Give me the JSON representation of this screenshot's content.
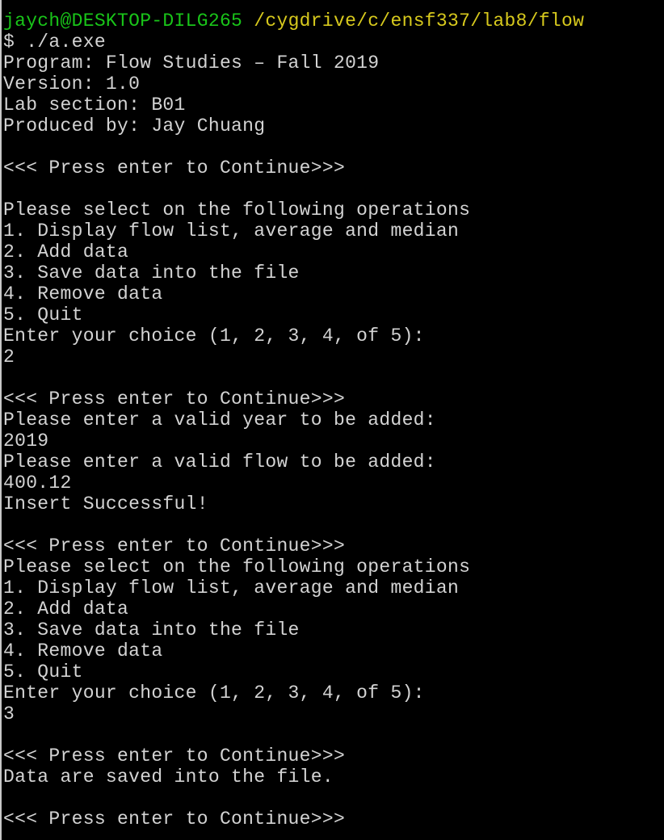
{
  "colors": {
    "background": "#000000",
    "text": "#d3d3d3",
    "prompt_user": "#19c419",
    "prompt_path": "#d7c91d"
  },
  "prompt": {
    "user_host": "jaych@DESKTOP-DILG265",
    "cwd": "/cygdrive/c/ensf337/lab8/flow",
    "command": "$ ./a.exe"
  },
  "output_lines": [
    "Program: Flow Studies – Fall 2019",
    "Version: 1.0",
    "Lab section: B01",
    "Produced by: Jay Chuang",
    "",
    "<<< Press enter to Continue>>>",
    "",
    "Please select on the following operations",
    "1. Display flow list, average and median",
    "2. Add data",
    "3. Save data into the file",
    "4. Remove data",
    "5. Quit",
    "Enter your choice (1, 2, 3, 4, of 5):",
    "2",
    "",
    "<<< Press enter to Continue>>>",
    "Please enter a valid year to be added:",
    "2019",
    "Please enter a valid flow to be added:",
    "400.12",
    "Insert Successful!",
    "",
    "<<< Press enter to Continue>>>",
    "Please select on the following operations",
    "1. Display flow list, average and median",
    "2. Add data",
    "3. Save data into the file",
    "4. Remove data",
    "5. Quit",
    "Enter your choice (1, 2, 3, 4, of 5):",
    "3",
    "",
    "<<< Press enter to Continue>>>",
    "Data are saved into the file.",
    "",
    "<<< Press enter to Continue>>>"
  ]
}
